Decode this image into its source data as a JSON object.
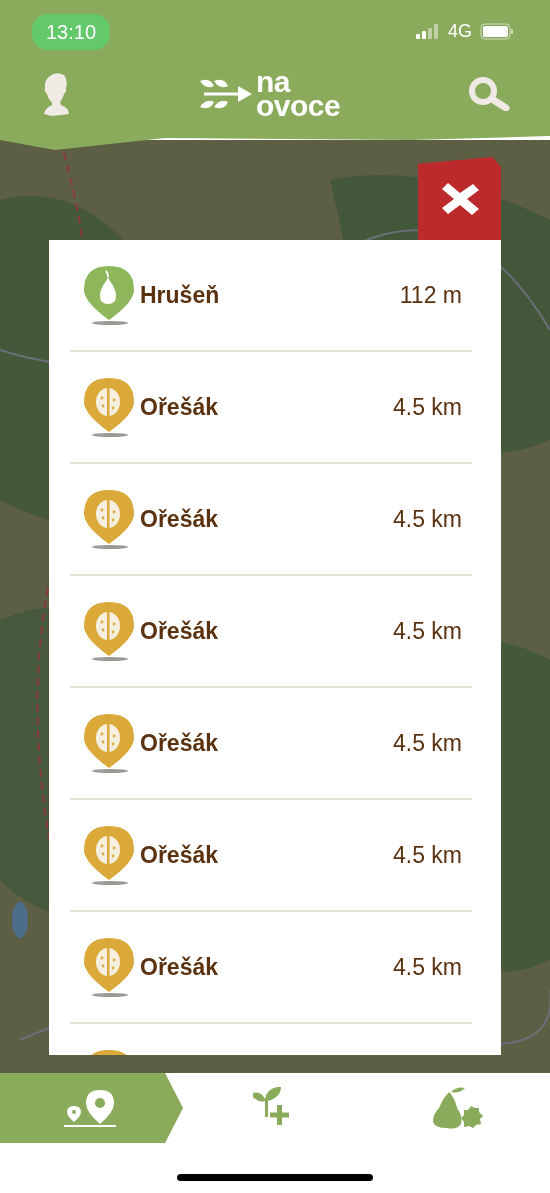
{
  "status_bar": {
    "time": "13:10",
    "network": "4G"
  },
  "header": {
    "logo": {
      "line1": "na",
      "line2": "ovoce"
    }
  },
  "results": [
    {
      "kind": "pear",
      "name": "Hrušeň",
      "distance": "112 m"
    },
    {
      "kind": "walnut",
      "name": "Ořešák",
      "distance": "4.5 km"
    },
    {
      "kind": "walnut",
      "name": "Ořešák",
      "distance": "4.5 km"
    },
    {
      "kind": "walnut",
      "name": "Ořešák",
      "distance": "4.5 km"
    },
    {
      "kind": "walnut",
      "name": "Ořešák",
      "distance": "4.5 km"
    },
    {
      "kind": "walnut",
      "name": "Ořešák",
      "distance": "4.5 km"
    },
    {
      "kind": "walnut",
      "name": "Ořešák",
      "distance": "4.5 km"
    },
    {
      "kind": "walnut"
    }
  ],
  "tabs": [
    {
      "kind": "map",
      "selected": true
    },
    {
      "kind": "add",
      "selected": false
    },
    {
      "kind": "fruits",
      "selected": false
    }
  ]
}
